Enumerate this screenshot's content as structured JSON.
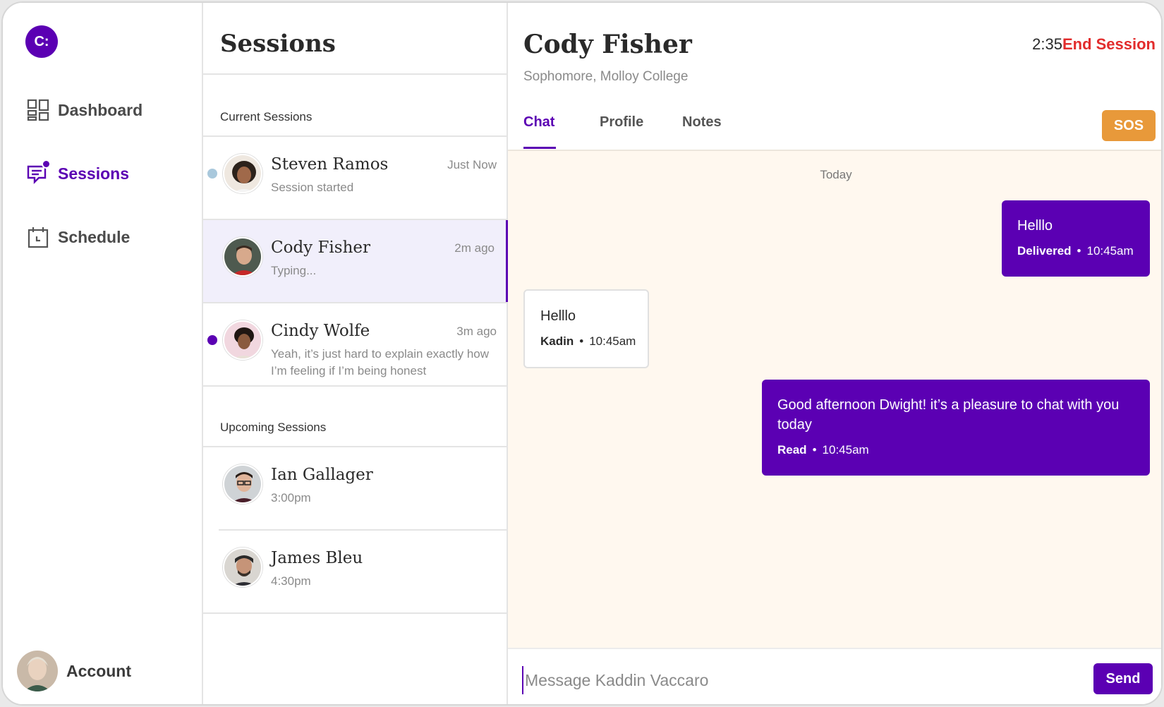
{
  "sidebar": {
    "logo_text": "C:",
    "items": [
      {
        "label": "Dashboard",
        "icon": "dashboard-icon"
      },
      {
        "label": "Sessions",
        "icon": "chat-icon",
        "active": true
      },
      {
        "label": "Schedule",
        "icon": "calendar-icon"
      }
    ],
    "account_label": "Account"
  },
  "sessions": {
    "title": "Sessions",
    "current_label": "Current Sessions",
    "upcoming_label": "Upcoming Sessions",
    "current": [
      {
        "name": "Steven Ramos",
        "sub": "Session started",
        "time": "Just Now",
        "dot_color": "#a9c8dc"
      },
      {
        "name": "Cody Fisher",
        "sub": "Typing...",
        "time": "2m ago",
        "selected": true
      },
      {
        "name": "Cindy Wolfe",
        "sub": "Yeah, it’s just hard to explain exactly how I’m feeling if I’m being honest",
        "time": "3m ago",
        "dot_color": "#5b00b3"
      }
    ],
    "upcoming": [
      {
        "name": "Ian Gallager",
        "sub": "3:00pm"
      },
      {
        "name": "James Bleu",
        "sub": "4:30pm"
      }
    ]
  },
  "chat": {
    "name": "Cody Fisher",
    "subtitle": "Sophomore, Molloy College",
    "timer": "2:35",
    "end_label": "End Session",
    "tabs": [
      "Chat",
      "Profile",
      "Notes"
    ],
    "sos_label": "SOS",
    "day_label": "Today",
    "messages": [
      {
        "text": "Helllo",
        "status": "Delivered",
        "time": "10:45am",
        "direction": "out"
      },
      {
        "text": "Helllo",
        "status": "Kadin",
        "time": "10:45am",
        "direction": "in"
      },
      {
        "text": "Good afternoon Dwight! it’s a pleasure to chat with you today",
        "status": "Read",
        "time": "10:45am",
        "direction": "out"
      }
    ],
    "composer_placeholder": "Message Kaddin Vaccaro",
    "send_label": "Send"
  },
  "colors": {
    "brand": "#5b00b3",
    "danger": "#e22c2c",
    "sos": "#e8993a",
    "chat_bg": "#fff8ef"
  }
}
